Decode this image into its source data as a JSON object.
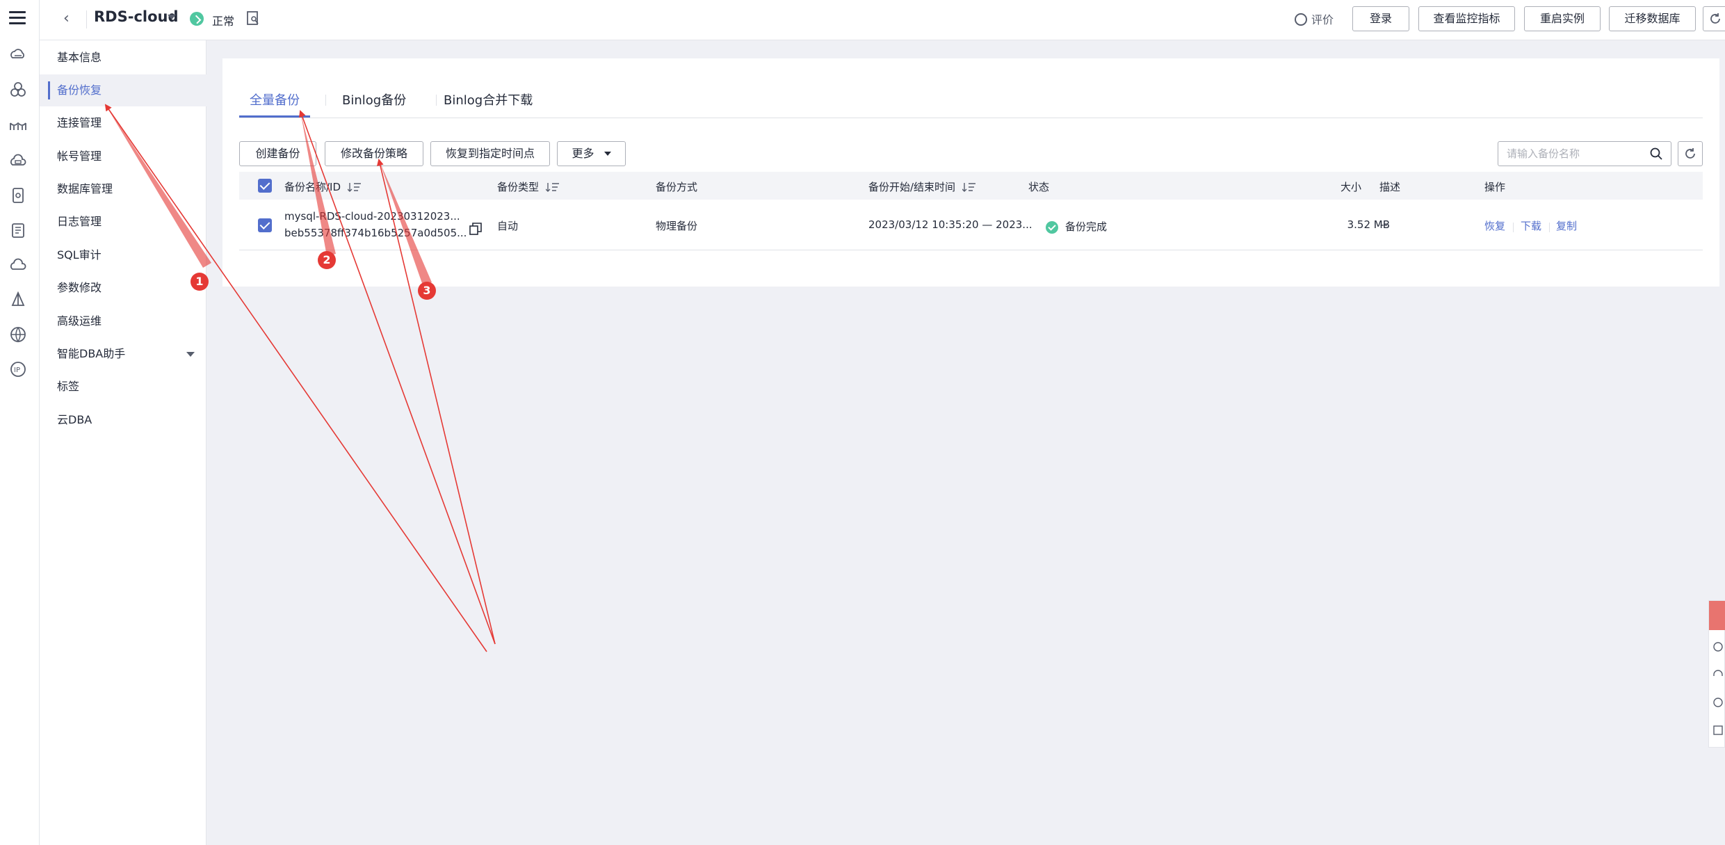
{
  "header": {
    "instance_name": "RDS-cloud",
    "status": "正常",
    "rate_label": "评价",
    "buttons": [
      "登录",
      "查看监控指标",
      "重启实例",
      "迁移数据库"
    ]
  },
  "sidebar": {
    "items": [
      {
        "label": "基本信息",
        "active": false
      },
      {
        "label": "备份恢复",
        "active": true
      },
      {
        "label": "连接管理",
        "active": false
      },
      {
        "label": "帐号管理",
        "active": false
      },
      {
        "label": "数据库管理",
        "active": false
      },
      {
        "label": "日志管理",
        "active": false
      },
      {
        "label": "SQL审计",
        "active": false
      },
      {
        "label": "参数修改",
        "active": false
      },
      {
        "label": "高级运维",
        "active": false
      },
      {
        "label": "智能DBA助手",
        "active": false
      },
      {
        "label": "标签",
        "active": false
      },
      {
        "label": "云DBA",
        "active": false
      }
    ]
  },
  "tabs": [
    "全量备份",
    "Binlog备份",
    "Binlog合并下载"
  ],
  "actions": {
    "create": "创建备份",
    "modify_policy": "修改备份策略",
    "restore_time": "恢复到指定时间点",
    "more": "更多"
  },
  "search": {
    "placeholder": "请输入备份名称"
  },
  "table": {
    "columns": [
      "备份名称/ID",
      "备份类型",
      "备份方式",
      "备份开始/结束时间",
      "状态",
      "大小",
      "描述",
      "操作"
    ],
    "rows": [
      {
        "name": "mysql-RDS-cloud-20230312023...",
        "id": "beb55378ff374b16b5257a0d505...",
        "type": "自动",
        "method": "物理备份",
        "time": "2023/03/12 10:35:20 — 2023...",
        "status": "备份完成",
        "size": "3.52 MB",
        "desc": "--",
        "ops": [
          "恢复",
          "下载",
          "复制"
        ]
      }
    ]
  },
  "annotations": [
    "1",
    "2",
    "3"
  ],
  "colors": {
    "accent": "#526ecc",
    "success": "#50c7a0",
    "annotation": "#e53935"
  }
}
